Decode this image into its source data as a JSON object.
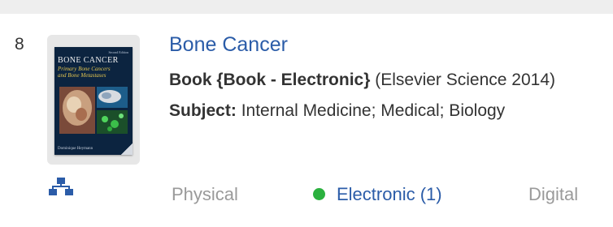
{
  "result": {
    "number": "8",
    "title": "Bone Cancer",
    "format_label": "Book {Book - Electronic}",
    "publisher": "(Elsevier Science 2014)",
    "subject_label": "Subject:",
    "subject_value": "Internal Medicine; Medical; Biology",
    "cover": {
      "title": "Bone Cancer",
      "subtitle_line1": "Primary Bone Cancers",
      "subtitle_line2": "and Bone Metastases",
      "edition": "Second Edition",
      "author": "Dominique Heymann"
    },
    "related_icon": "hierarchy-icon",
    "availability": {
      "physical": "Physical",
      "electronic": "Electronic (1)",
      "digital": "Digital",
      "electronic_status_color": "#2bb13f"
    }
  },
  "colors": {
    "link": "#2b5ca8",
    "text": "#333333",
    "muted": "#9a9a9a",
    "top_band": "#eeeeee"
  }
}
